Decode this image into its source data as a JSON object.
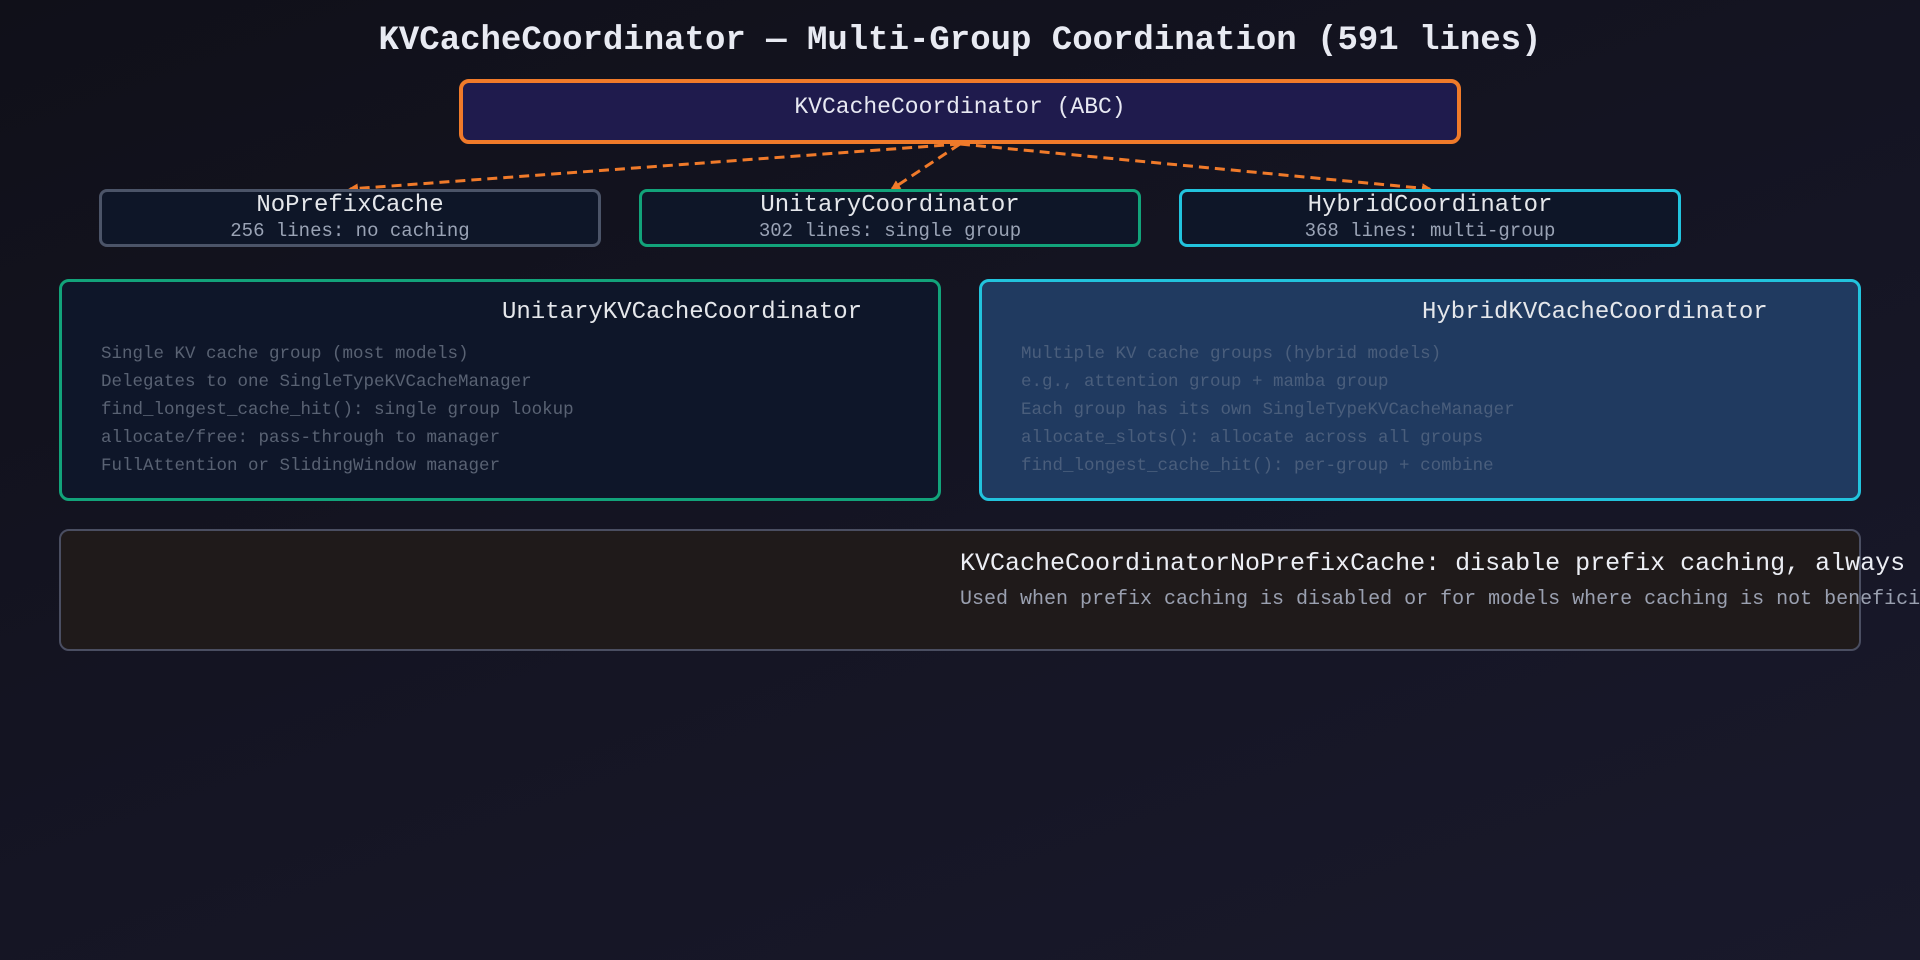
{
  "title": "KVCacheCoordinator — Multi-Group Coordination (591 lines)",
  "colors": {
    "abc_border": "#f07a2a",
    "abc_fill": "#1f1b4d",
    "arrow": "#f07a2a",
    "noprefix_border": "#4b5468",
    "unitary_border": "#12a37a",
    "hybrid_border": "#22c3dd",
    "bottom_border": "#4a4e61"
  },
  "abc_box": {
    "label": "KVCacheCoordinator (ABC)"
  },
  "implementations": [
    {
      "name": "NoPrefixCache",
      "subtitle": "256 lines: no caching"
    },
    {
      "name": "UnitaryCoordinator",
      "subtitle": "302 lines: single group"
    },
    {
      "name": "HybridCoordinator",
      "subtitle": "368 lines: multi-group"
    }
  ],
  "unitary_detail": {
    "heading": "UnitaryKVCacheCoordinator",
    "items": [
      "Single KV cache group (most models)",
      "Delegates to one SingleTypeKVCacheManager",
      "find_longest_cache_hit(): single group lookup",
      "allocate/free: pass-through to manager",
      "FullAttention or SlidingWindow manager"
    ]
  },
  "hybrid_detail": {
    "heading": "HybridKVCacheCoordinator",
    "items": [
      "Multiple KV cache groups (hybrid models)",
      "e.g., attention group + mamba group",
      "Each group has its own SingleTypeKVCacheManager",
      "allocate_slots(): allocate across all groups",
      "find_longest_cache_hit(): per-group + combine"
    ]
  },
  "no_prefix_note": {
    "heading": "KVCacheCoordinatorNoPrefixCache: disable prefix caching, always allocate fresh",
    "subtitle": "Used when prefix caching is disabled or for models where caching is not beneficial"
  }
}
